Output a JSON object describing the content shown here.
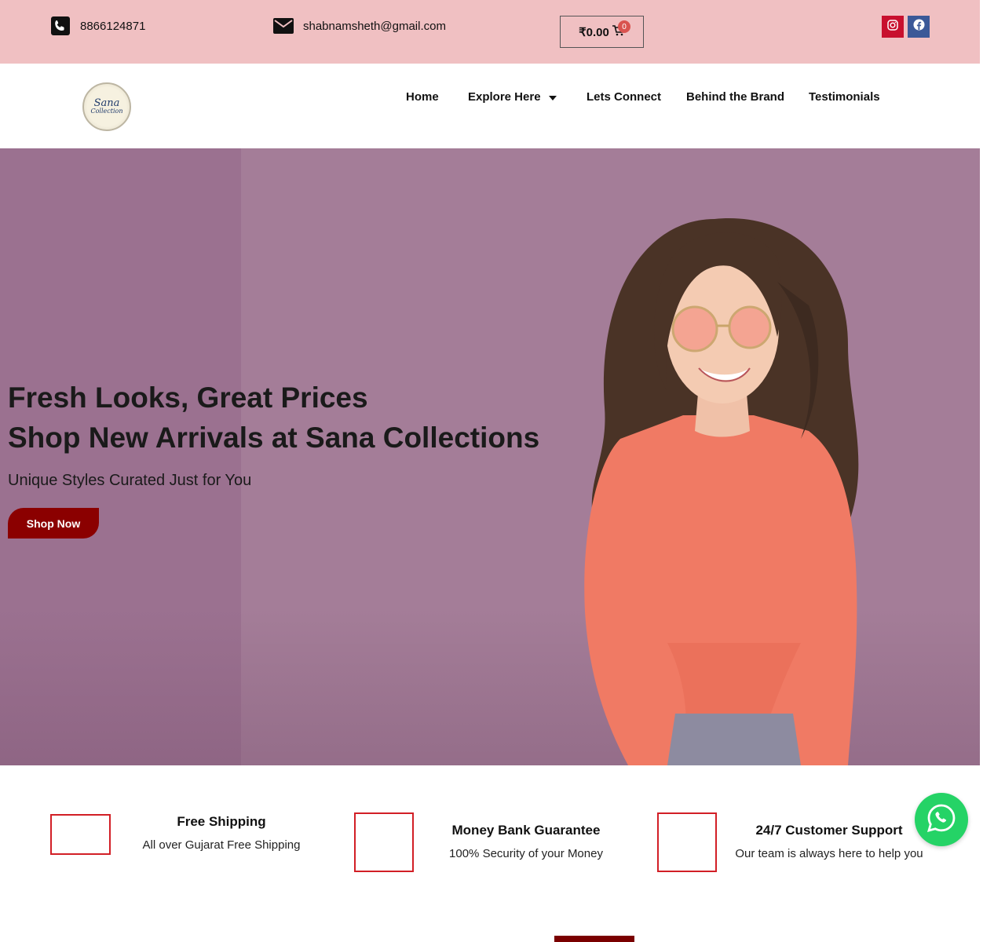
{
  "topbar": {
    "phone": "8866124871",
    "email": "shabnamsheth@gmail.com",
    "cart_total": "₹0.00",
    "cart_count": "0",
    "social": [
      "instagram-icon",
      "facebook-icon"
    ]
  },
  "logo": {
    "line1": "Sana",
    "line2": "Collection"
  },
  "nav": {
    "items": [
      "Home",
      "Explore Here",
      "Lets Connect",
      "Behind the Brand",
      "Testimonials"
    ]
  },
  "hero": {
    "title_line1": "Fresh Looks, Great Prices",
    "title_line2": "Shop New Arrivals at Sana Collections",
    "subtitle": "Unique Styles Curated Just for You",
    "cta": "Shop Now"
  },
  "features": [
    {
      "title": "Free Shipping",
      "desc": "All over Gujarat Free Shipping"
    },
    {
      "title": "Money Bank Guarantee",
      "desc": "100% Security of your Money"
    },
    {
      "title": "24/7 Customer Support",
      "desc": "Our team is always here to help you"
    }
  ],
  "bottom": {
    "heading": ""
  },
  "colors": {
    "topbar_bg": "#f0c0c2",
    "hero_bg": "#a47d98",
    "accent": "#8b0000",
    "feature_border": "#d21f26",
    "whatsapp": "#25d366"
  }
}
